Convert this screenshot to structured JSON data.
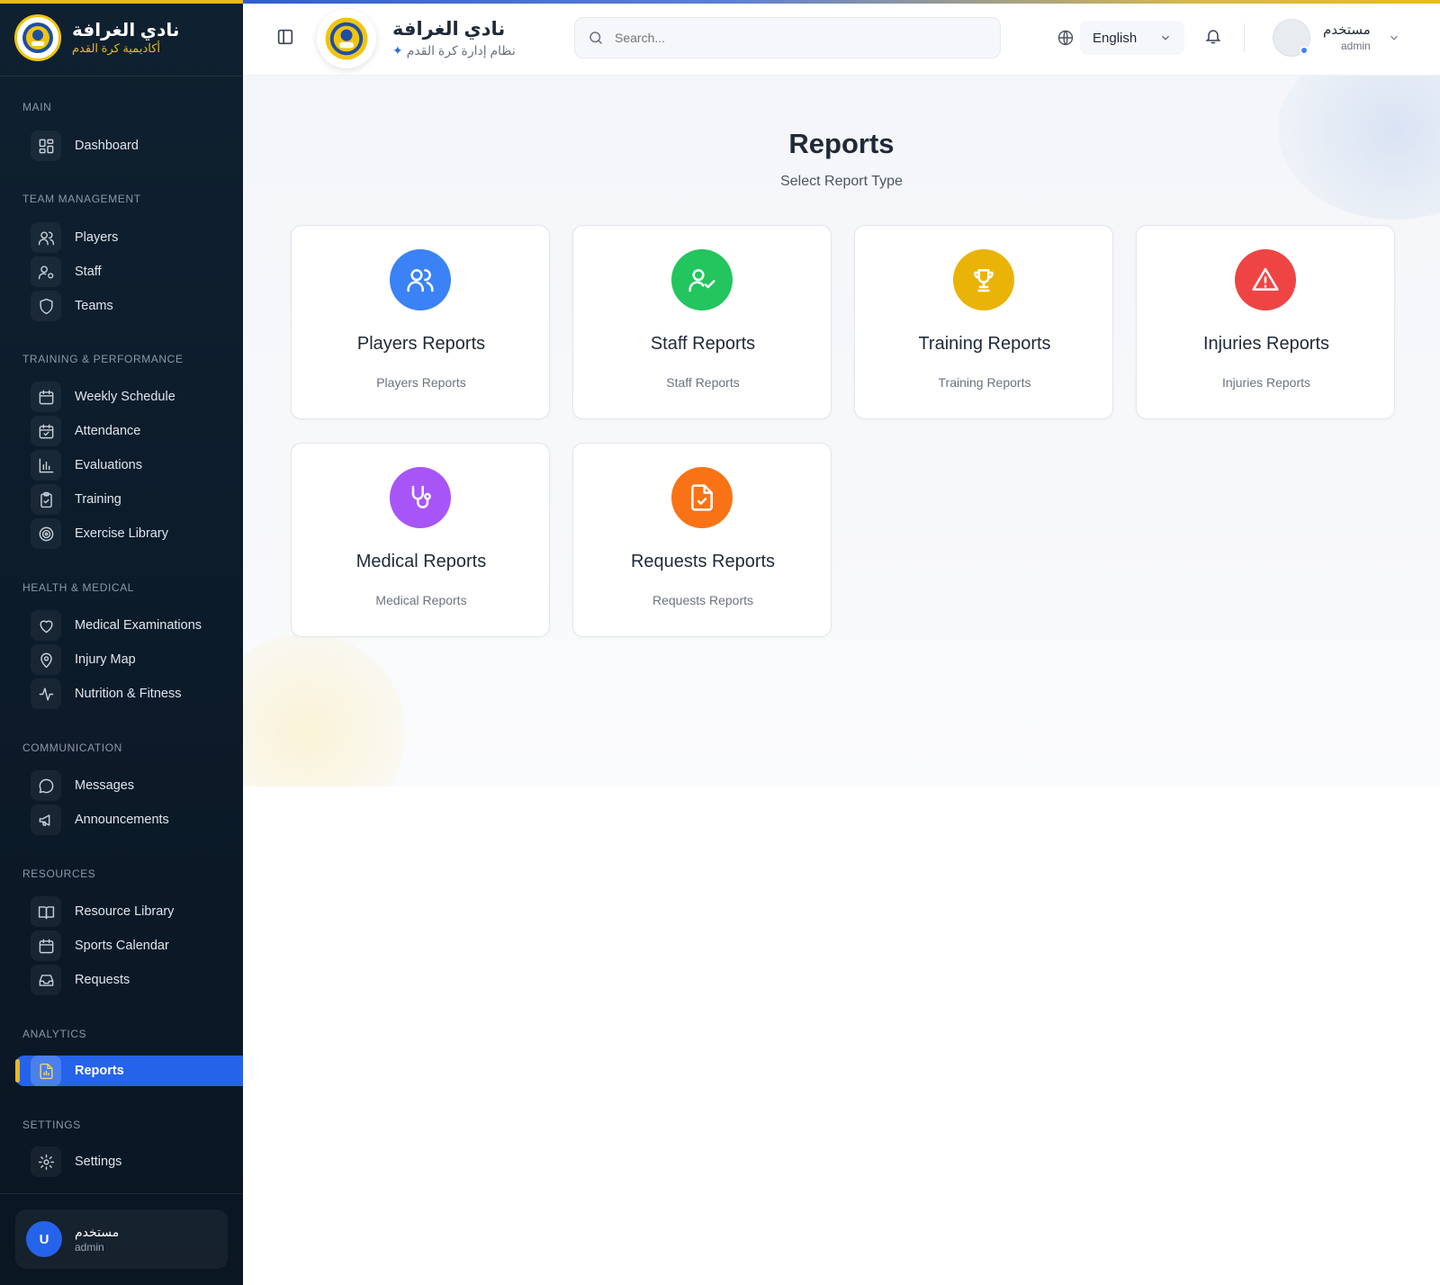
{
  "brand": {
    "name": "نادي الغرافة",
    "subtitle": "أكاديمية كرة القدم"
  },
  "sidebar": {
    "sections": {
      "main": "MAIN",
      "team": "TEAM MANAGEMENT",
      "training": "TRAINING & PERFORMANCE",
      "health": "HEALTH & MEDICAL",
      "communication": "COMMUNICATION",
      "resources": "RESOURCES",
      "analytics": "ANALYTICS",
      "settings": "SETTINGS"
    },
    "items": {
      "dashboard": "Dashboard",
      "players": "Players",
      "staff": "Staff",
      "teams": "Teams",
      "weekly_schedule": "Weekly Schedule",
      "attendance": "Attendance",
      "evaluations": "Evaluations",
      "training": "Training",
      "exercise_library": "Exercise Library",
      "medical_examinations": "Medical Examinations",
      "injury_map": "Injury Map",
      "nutrition_fitness": "Nutrition & Fitness",
      "messages": "Messages",
      "announcements": "Announcements",
      "resource_library": "Resource Library",
      "sports_calendar": "Sports Calendar",
      "requests": "Requests",
      "reports": "Reports",
      "settings": "Settings"
    },
    "active_item": "reports",
    "user": {
      "initial": "U",
      "name": "مستخدم",
      "role": "admin"
    }
  },
  "header": {
    "title": "نادي الغرافة",
    "subtitle": "نظام إدارة كرة القدم",
    "search_placeholder": "Search...",
    "language": "English",
    "user_name": "مستخدم",
    "user_role": "admin"
  },
  "page": {
    "title": "Reports",
    "subtitle": "Select Report Type"
  },
  "report_cards": [
    {
      "title": "Players Reports",
      "subtitle": "Players Reports",
      "icon": "users-icon",
      "color": "#3b82f6"
    },
    {
      "title": "Staff Reports",
      "subtitle": "Staff Reports",
      "icon": "user-check-icon",
      "color": "#22c55e"
    },
    {
      "title": "Training Reports",
      "subtitle": "Training Reports",
      "icon": "trophy-icon",
      "color": "#eab308"
    },
    {
      "title": "Injuries Reports",
      "subtitle": "Injuries Reports",
      "icon": "alert-triangle-icon",
      "color": "#ef4444"
    },
    {
      "title": "Medical Reports",
      "subtitle": "Medical Reports",
      "icon": "stethoscope-icon",
      "color": "#a855f7"
    },
    {
      "title": "Requests Reports",
      "subtitle": "Requests Reports",
      "icon": "file-check-icon",
      "color": "#f97316"
    }
  ],
  "colors": {
    "sidebar_bg": "#0f2030",
    "accent_blue": "#2563eb",
    "accent_gold": "#e8b923"
  }
}
